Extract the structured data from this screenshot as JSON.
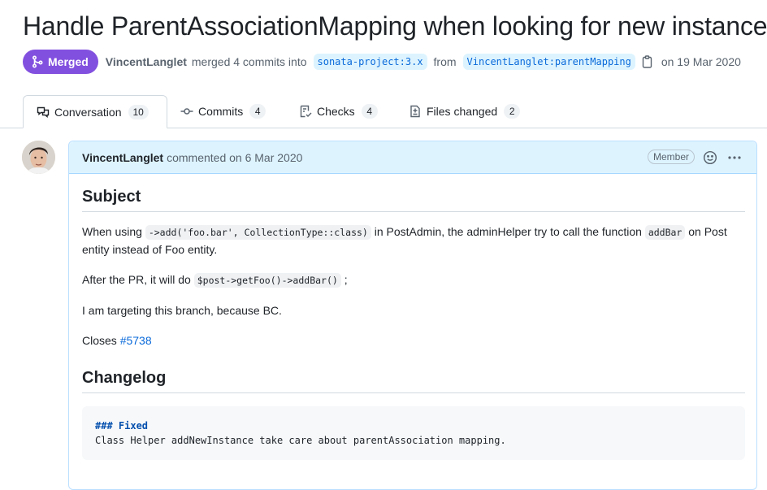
{
  "pr": {
    "title": "Handle ParentAssociationMapping when looking for new instance #",
    "state": "Merged",
    "author": "VincentLanglet",
    "merge_text": "merged 4 commits into",
    "base_branch": "sonata-project:3.x",
    "from_text": "from",
    "head_branch": "VincentLanglet:parentMapping",
    "date_text": "on 19 Mar 2020"
  },
  "tabs": [
    {
      "label": "Conversation",
      "count": "10",
      "icon": "comment-discussion-icon"
    },
    {
      "label": "Commits",
      "count": "4",
      "icon": "git-commit-icon"
    },
    {
      "label": "Checks",
      "count": "4",
      "icon": "checklist-icon"
    },
    {
      "label": "Files changed",
      "count": "2",
      "icon": "file-diff-icon"
    }
  ],
  "comment": {
    "author": "VincentLanglet",
    "action": "commented on 6 Mar 2020",
    "role": "Member",
    "body": {
      "h_subject": "Subject",
      "p1_a": "When using ",
      "p1_code1": "->add('foo.bar', CollectionType::class)",
      "p1_b": " in PostAdmin, the adminHelper try to call the function ",
      "p1_code2": "addBar",
      "p1_c": " on Post entity instead of Foo entity.",
      "p2_a": "After the PR, it will do ",
      "p2_code": "$post->getFoo()->addBar()",
      "p2_b": " ;",
      "p3": "I am targeting this branch, because BC.",
      "p4_a": "Closes ",
      "p4_link": "#5738",
      "h_changelog": "Changelog",
      "code_heading": "### Fixed",
      "code_line": "Class Helper addNewInstance take care about parentAssociation mapping."
    }
  },
  "colors": {
    "merged": "#8250df",
    "link": "#0969da",
    "header_bg": "#ddf4ff"
  }
}
